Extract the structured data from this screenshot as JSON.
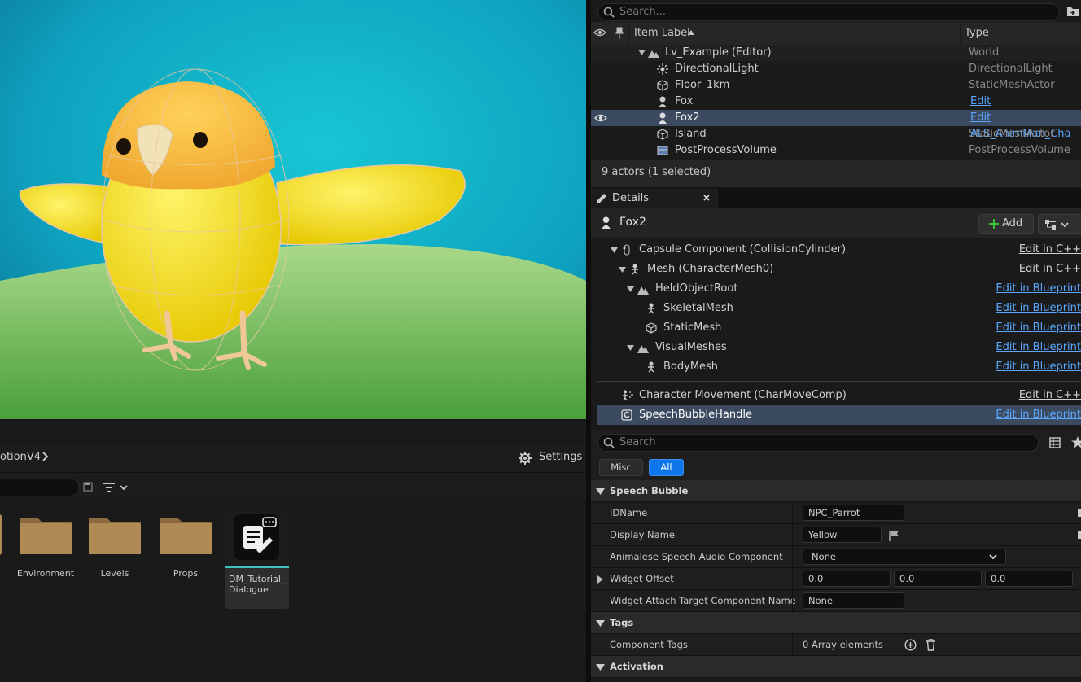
{
  "outliner": {
    "search_placeholder": "Search...",
    "col_label": "Item Label",
    "col_type": "Type",
    "rows": [
      {
        "label": "Lv_Example (Editor)",
        "type": "World"
      },
      {
        "label": "DirectionalLight",
        "type": "DirectionalLight"
      },
      {
        "label": "Floor_1km",
        "type": "StaticMeshActor"
      },
      {
        "label": "Fox",
        "type": "Edit ALS_AnimMan_Cha"
      },
      {
        "label": "Fox2",
        "type": "Edit ALS_AnimMan_Cha"
      },
      {
        "label": "Island",
        "type": "StaticMeshActor"
      },
      {
        "label": "PostProcessVolume",
        "type": "PostProcessVolume"
      }
    ],
    "status": "9 actors (1 selected)"
  },
  "details": {
    "tab_title": "Details",
    "actor_name": "Fox2",
    "add_label": "Add",
    "components": [
      {
        "label": "Capsule Component (CollisionCylinder)",
        "edit": "Edit in C++"
      },
      {
        "label": "Mesh (CharacterMesh0)",
        "edit": "Edit in C++"
      },
      {
        "label": "HeldObjectRoot",
        "edit": "Edit in Blueprint"
      },
      {
        "label": "SkeletalMesh",
        "edit": "Edit in Blueprint"
      },
      {
        "label": "StaticMesh",
        "edit": "Edit in Blueprint"
      },
      {
        "label": "VisualMeshes",
        "edit": "Edit in Blueprint"
      },
      {
        "label": "BodyMesh",
        "edit": "Edit in Blueprint"
      },
      {
        "label": "Character Movement (CharMoveComp)",
        "edit": "Edit in C++"
      },
      {
        "label": "SpeechBubbleHandle",
        "edit": "Edit in Blueprint"
      }
    ],
    "search_placeholder": "Search",
    "filter_misc": "Misc",
    "filter_all": "All",
    "cat_speech": "Speech Bubble",
    "idname_label": "IDName",
    "idname_value": "NPC_Parrot",
    "display_label": "Display Name",
    "display_value": "Yellow",
    "audio_label": "Animalese Speech Audio Component",
    "audio_value": "None",
    "offset_label": "Widget Offset",
    "offset_x": "0.0",
    "offset_y": "0.0",
    "offset_z": "0.0",
    "attach_label": "Widget Attach Target Component Name",
    "attach_value": "None",
    "cat_tags": "Tags",
    "tags_label": "Component Tags",
    "tags_value": "0 Array elements",
    "cat_activation": "Activation"
  },
  "content_browser": {
    "path_tail": "otionV4",
    "settings_label": "Settings",
    "items": [
      {
        "label": "Environment"
      },
      {
        "label": "Levels"
      },
      {
        "label": "Props"
      },
      {
        "label": "DM_Tutorial_ Dialogue"
      }
    ]
  },
  "colors": {
    "accent": "#0e76e8",
    "link": "#5aa8ff",
    "selection": "#3b4a5e",
    "folder": "#b08a55"
  }
}
